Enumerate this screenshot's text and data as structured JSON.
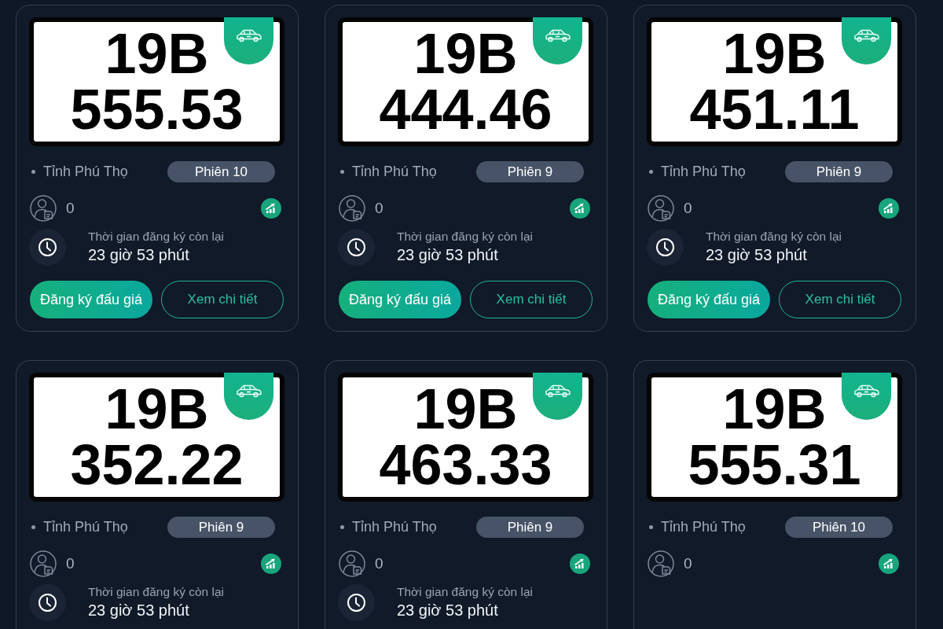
{
  "cards": [
    {
      "plate": {
        "series": "19B",
        "number": "555.53"
      },
      "location": "Tỉnh Phú Thọ",
      "session": "Phiên 10",
      "bidders": "0",
      "time_label": "Thời gian đăng ký còn lại",
      "time_left": "23 giờ 53 phút",
      "buttons": [
        {
          "label": "Đăng ký đấu giá",
          "kind": "primary"
        },
        {
          "label": "Xem chi tiết",
          "kind": "outline"
        }
      ]
    },
    {
      "plate": {
        "series": "19B",
        "number": "444.46"
      },
      "location": "Tỉnh Phú Thọ",
      "session": "Phiên 9",
      "bidders": "0",
      "time_label": "Thời gian đăng ký còn lại",
      "time_left": "23 giờ 53 phút",
      "buttons": [
        {
          "label": "Đăng ký đấu giá",
          "kind": "primary"
        },
        {
          "label": "Xem chi tiết",
          "kind": "outline"
        }
      ]
    },
    {
      "plate": {
        "series": "19B",
        "number": "451.11"
      },
      "location": "Tỉnh Phú Thọ",
      "session": "Phiên 9",
      "bidders": "0",
      "time_label": "Thời gian đăng ký còn lại",
      "time_left": "23 giờ 53 phút",
      "buttons": [
        {
          "label": "Đăng ký đấu giá",
          "kind": "primary"
        },
        {
          "label": "Xem chi tiết",
          "kind": "outline"
        }
      ]
    },
    {
      "plate": {
        "series": "19B",
        "number": "352.22"
      },
      "location": "Tỉnh Phú Thọ",
      "session": "Phiên 9",
      "bidders": "0",
      "time_label": "Thời gian đăng ký còn lại",
      "time_left": "23 giờ 53 phút"
    },
    {
      "plate": {
        "series": "19B",
        "number": "463.33"
      },
      "location": "Tỉnh Phú Thọ",
      "session": "Phiên 9",
      "bidders": "0",
      "time_label": "Thời gian đăng ký còn lại",
      "time_left": "23 giờ 53 phút"
    },
    {
      "plate": {
        "series": "19B",
        "number": "555.31"
      },
      "location": "Tỉnh Phú Thọ",
      "session": "Phiên 10",
      "bidders": "0"
    }
  ]
}
